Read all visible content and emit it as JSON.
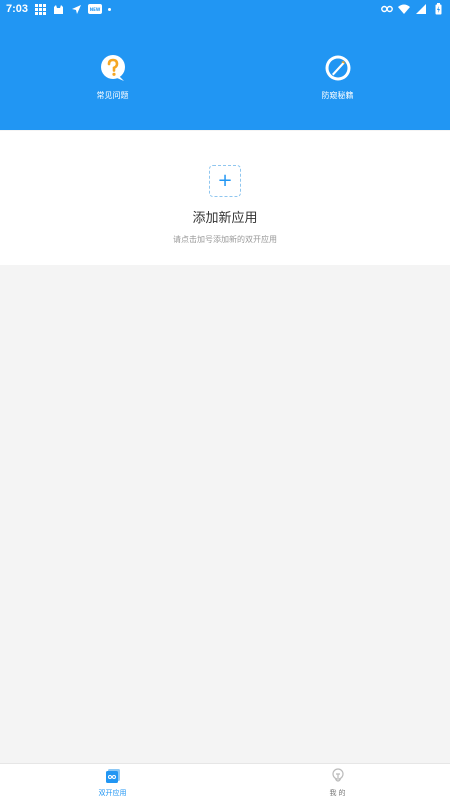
{
  "status_bar": {
    "time": "7:03",
    "badge_text": "NEW"
  },
  "header": {
    "items": [
      {
        "label": "常见问题",
        "icon": "question-icon"
      },
      {
        "label": "防窥秘籍",
        "icon": "compass-icon"
      }
    ]
  },
  "card": {
    "title": "添加新应用",
    "subtitle": "请点击加号添加新的双开应用",
    "add_symbol": "+"
  },
  "tabs": [
    {
      "label": "双开应用",
      "icon": "clone-apps-icon",
      "active": true
    },
    {
      "label": "我 的",
      "icon": "profile-icon",
      "active": false
    }
  ],
  "colors": {
    "primary": "#2196f3",
    "orange": "#f5a623",
    "background": "#f4f4f4"
  }
}
